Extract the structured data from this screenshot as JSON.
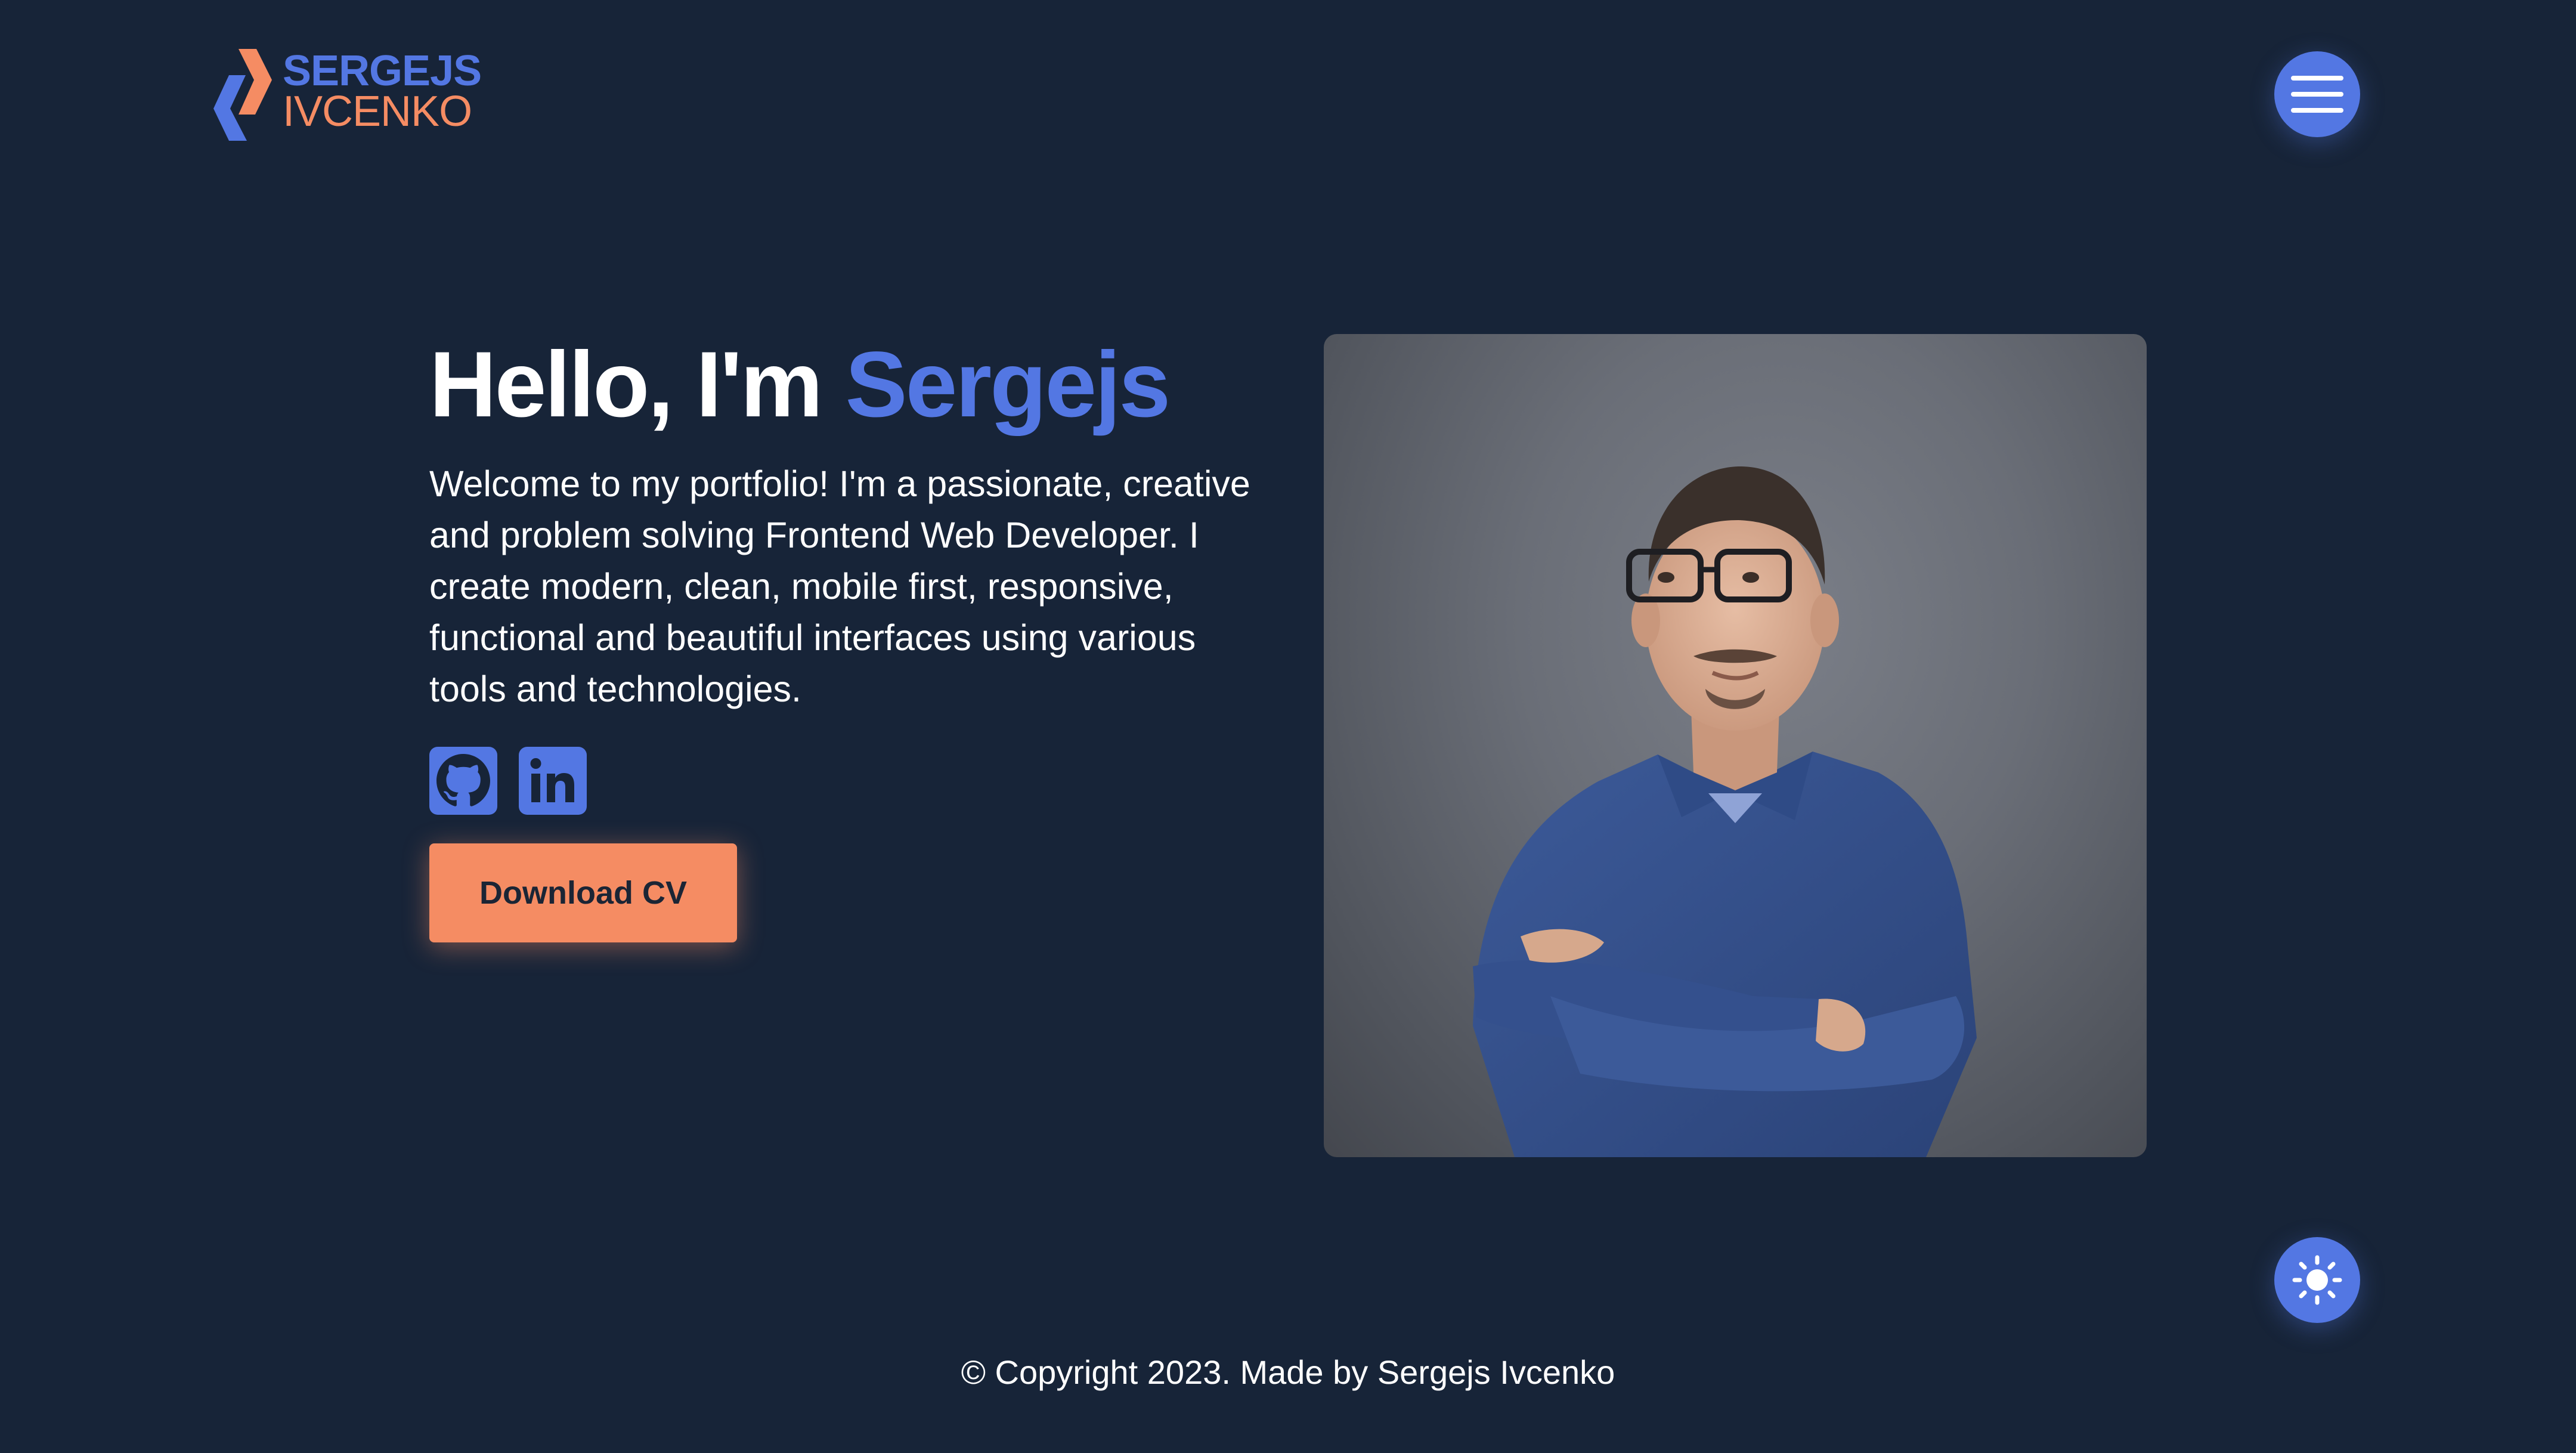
{
  "header": {
    "logo_line1": "SERGEJS",
    "logo_line2": "IVCENKO",
    "menu_icon": "hamburger-menu-icon"
  },
  "hero": {
    "greeting": "Hello, I'm ",
    "name": "Sergejs",
    "description": "Welcome to my portfolio! I'm a passionate, creative and problem solving Frontend Web Developer. I create modern, clean, mobile first, responsive, functional and beautiful interfaces using various tools and technologies.",
    "social": [
      {
        "icon": "github-icon"
      },
      {
        "icon": "linkedin-icon"
      }
    ],
    "cv_button": "Download CV"
  },
  "theme_toggle": {
    "icon": "sun-icon"
  },
  "footer": {
    "text": "© Copyright 2023. Made by Sergejs Ivcenko"
  },
  "colors": {
    "background": "#172438",
    "primary": "#5377E3",
    "accent": "#F58C63",
    "text": "#FFFFFF"
  }
}
